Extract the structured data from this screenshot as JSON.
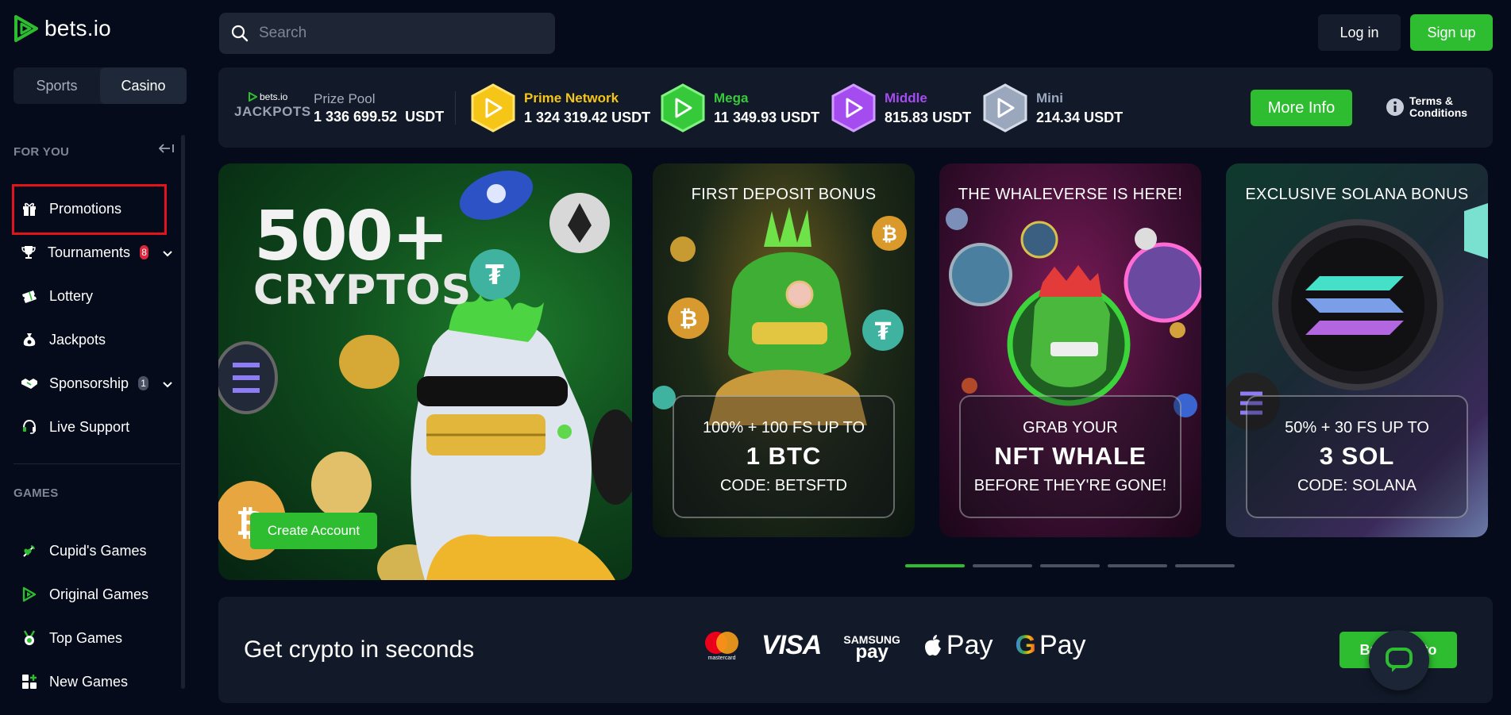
{
  "brand": {
    "name": "bets.io"
  },
  "search": {
    "placeholder": "Search"
  },
  "auth": {
    "login": "Log in",
    "signup": "Sign up"
  },
  "sidebar": {
    "modes": [
      "Sports",
      "Casino"
    ],
    "active_mode": "Casino",
    "section_for_you": "FOR YOU",
    "section_games": "GAMES",
    "items": [
      {
        "label": "Promotions",
        "icon": "gift-icon"
      },
      {
        "label": "Tournaments",
        "icon": "trophy-icon",
        "badge": "8"
      },
      {
        "label": "Lottery",
        "icon": "ticket-icon"
      },
      {
        "label": "Jackpots",
        "icon": "money-bag-icon"
      },
      {
        "label": "Sponsorship",
        "icon": "handshake-icon",
        "badge": "1"
      },
      {
        "label": "Live Support",
        "icon": "headset-icon"
      }
    ],
    "games": [
      {
        "label": "Cupid's Games",
        "icon": "cupid-icon"
      },
      {
        "label": "Original Games",
        "icon": "original-icon"
      },
      {
        "label": "Top Games",
        "icon": "medal-icon"
      },
      {
        "label": "New Games",
        "icon": "new-icon"
      }
    ]
  },
  "jackpots": {
    "logo_small": "bets.io",
    "logo_big": "JACKPOTS",
    "prize_label": "Prize Pool",
    "prize_value": "1 336 699.52",
    "prize_currency": "USDT",
    "tiers": [
      {
        "name": "Prime Network",
        "amount": "1 324 319.42",
        "currency": "USDT",
        "color": "#f5c518"
      },
      {
        "name": "Mega",
        "amount": "11 349.93",
        "currency": "USDT",
        "color": "#36c93a"
      },
      {
        "name": "Middle",
        "amount": "815.83",
        "currency": "USDT",
        "color": "#a54cf0"
      },
      {
        "name": "Mini",
        "amount": "214.34",
        "currency": "USDT",
        "color": "#9aa7bd"
      }
    ],
    "more_info": "More Info",
    "terms": "Terms &",
    "terms2": "Conditions"
  },
  "hero": {
    "title1": "500+",
    "title2": "CRYPTOS",
    "cta": "Create Account"
  },
  "promos": [
    {
      "header": "FIRST DEPOSIT BONUS",
      "line1": "100% + 100 FS UP TO",
      "line2": "1 BTC",
      "line3": "CODE: BETSFTD"
    },
    {
      "header": "THE WHALEVERSE IS HERE!",
      "line1": "GRAB YOUR",
      "line2": "NFT WHALE",
      "line3": "BEFORE THEY'RE GONE!"
    },
    {
      "header": "EXCLUSIVE SOLANA BONUS",
      "line1": "50% + 30 FS UP TO",
      "line2": "3 SOL",
      "line3": "CODE: SOLANA"
    }
  ],
  "carousel": {
    "count": 5,
    "active": 0
  },
  "crypto": {
    "title": "Get crypto in seconds",
    "mastercard": "mastercard",
    "visa": "VISA",
    "samsung_top": "SAMSUNG",
    "samsung_bottom": "pay",
    "apple": "Pay",
    "google": "Pay",
    "buy": "Buy Crypto"
  },
  "colors": {
    "accent": "#2ebd30",
    "bg": "#050b1a",
    "panel": "#121a2a",
    "highlight": "#e3131d"
  }
}
